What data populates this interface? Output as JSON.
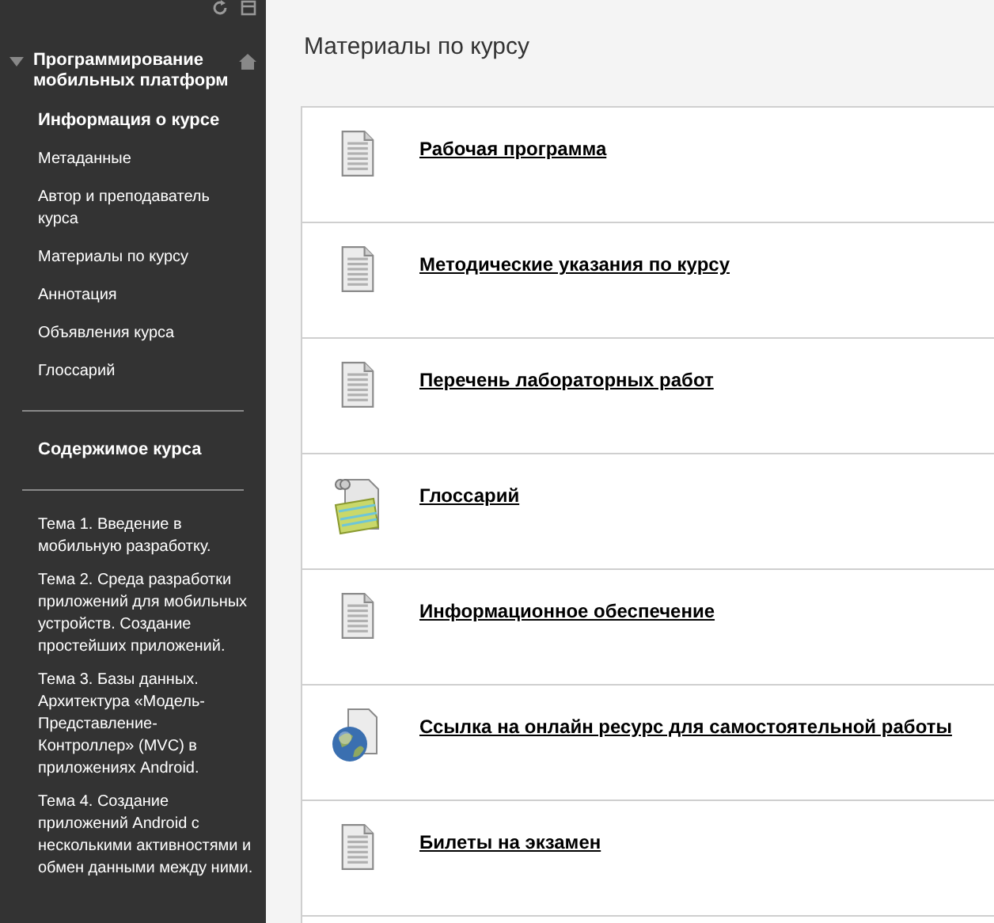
{
  "sidebar": {
    "course_title": "Программирование мобильных платформ",
    "sections": [
      {
        "heading": "Информация о курсе",
        "items": [
          "Метаданные",
          "Автор и преподаватель курса",
          "Материалы по курсу",
          "Аннотация",
          "Объявления курса",
          "Глоссарий"
        ]
      },
      {
        "heading": "Содержимое курса",
        "items": [
          "Тема 1. Введение в мобильную разработку.",
          "Тема 2. Среда разработки приложений для мобильных устройств. Создание простейших приложений.",
          "Тема 3. Базы данных. Архитектура «Модель-Представление-Контроллер» (MVC) в приложениях Android.",
          "Тема 4. Создание приложений Android с несколькими активностями и обмен данными между ними."
        ]
      }
    ]
  },
  "page_title": "Материалы по курсу",
  "items": [
    {
      "kind": "document",
      "title": "Рабочая программа"
    },
    {
      "kind": "document",
      "title": "Методические указания по курсу"
    },
    {
      "kind": "document",
      "title": "Перечень лабораторных работ"
    },
    {
      "kind": "glossary",
      "title": "Глоссарий"
    },
    {
      "kind": "document",
      "title": "Информационное обеспечение"
    },
    {
      "kind": "link",
      "title": "Ссылка на онлайн ресурс для самостоятельной работы"
    },
    {
      "kind": "document",
      "title": "Билеты на экзамен"
    }
  ]
}
